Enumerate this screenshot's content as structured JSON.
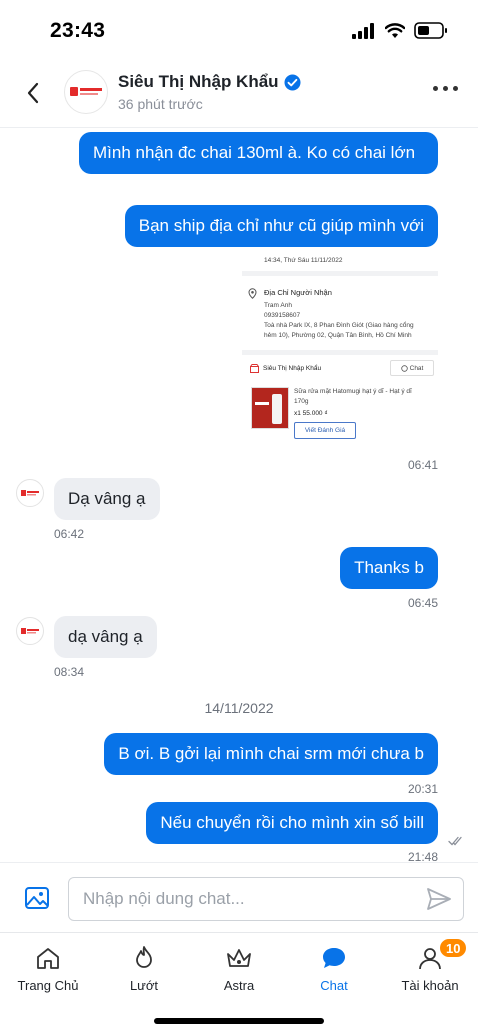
{
  "status_bar": {
    "time": "23:43"
  },
  "header": {
    "name": "Siêu Thị Nhập Khẩu",
    "subtitle": "36 phút trước",
    "avatar_logo_text": "SIÊU THỊ NHẬP KHẨU"
  },
  "messages": {
    "m1": "Mình nhận đc chai 130ml à. Ko có chai lớn",
    "m2": "Bạn ship địa chỉ như cũ giúp mình với",
    "m3_time": "06:41",
    "m4": "Dạ vâng ạ",
    "m4_time": "06:42",
    "m5": "Thanks b",
    "m5_time": "06:45",
    "m6": "dạ vâng ạ",
    "m6_time": "08:34",
    "date_separator": "14/11/2022",
    "m7": "B ơi. B gởi lại mình chai srm mới chưa b",
    "m7_time": "20:31",
    "m8": "Nếu chuyển rồi cho mình xin số bill",
    "m8_time": "21:48"
  },
  "shared_screenshot": {
    "timestamp": "14:34, Thứ Sáu 11/11/2022",
    "address_title": "Địa Chỉ Người Nhận",
    "recipient_name": "Tram Anh",
    "recipient_phone": "0939158607",
    "address_line1": "Toà nhà Park IX, 8 Phan Đình Giót (Giao hàng cổng",
    "address_line2": "hẻm 10), Phường 02, Quận Tân Bình, Hồ Chí Minh",
    "shop_name": "Siêu Thị Nhập Khẩu",
    "chat_label": "Chat",
    "product_line1": "Sữa rửa mặt Hatomugi hạt ý dĩ - Hạt ý dĩ",
    "product_line2": "170g",
    "quantity_price": "x1  55.000 ₫",
    "review_button": "Viết Đánh Giá"
  },
  "input": {
    "placeholder": "Nhập nội dung chat..."
  },
  "tabs": [
    {
      "label": "Trang Chủ",
      "icon": "home-icon"
    },
    {
      "label": "Lướt",
      "icon": "flame-icon"
    },
    {
      "label": "Astra",
      "icon": "crown-icon"
    },
    {
      "label": "Chat",
      "icon": "chat-bubble-icon",
      "active": true
    },
    {
      "label": "Tài khoản",
      "icon": "user-icon",
      "badge": "10"
    }
  ],
  "colors": {
    "accent": "#0873e8",
    "incoming_bubble": "#eceef2",
    "badge": "#ff8a00"
  }
}
